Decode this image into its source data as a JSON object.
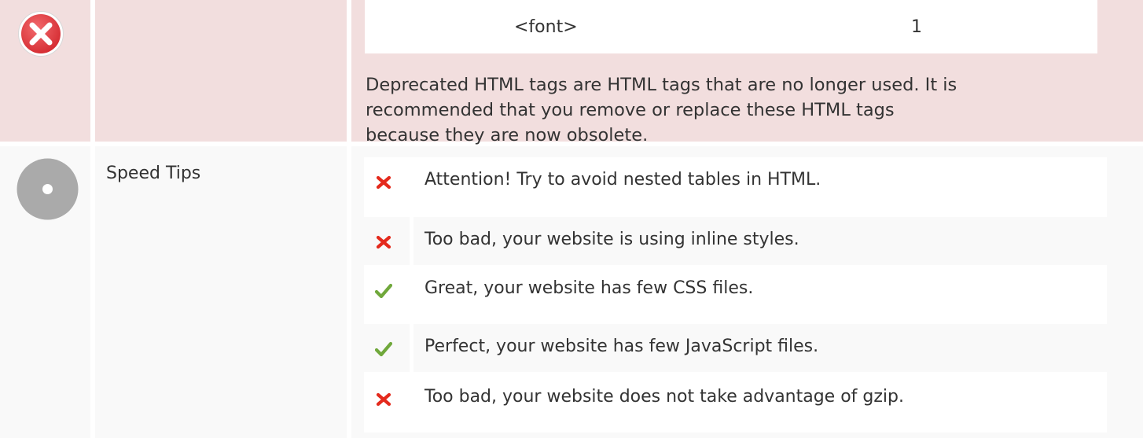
{
  "deprecated": {
    "status_icon": "error-circle-icon",
    "tag_name": "<font>",
    "tag_count": "1",
    "description": "Deprecated HTML tags are HTML tags that are no longer used. It is recommended that you remove or replace these HTML tags because they are now obsolete."
  },
  "speed_tips": {
    "status_icon": "neutral-circle-icon",
    "title": "Speed Tips",
    "tips": [
      {
        "status": "fail",
        "icon": "cross-icon",
        "text": "Attention! Try to avoid nested tables in HTML."
      },
      {
        "status": "fail",
        "icon": "cross-icon",
        "text": "Too bad, your website is using inline styles."
      },
      {
        "status": "pass",
        "icon": "check-icon",
        "text": "Great, your website has few CSS files."
      },
      {
        "status": "pass",
        "icon": "check-icon",
        "text": "Perfect, your website has few JavaScript files."
      },
      {
        "status": "fail",
        "icon": "cross-icon",
        "text": "Too bad, your website does not take advantage of gzip."
      }
    ]
  },
  "colors": {
    "error_bg": "#f2dede",
    "neutral_bg": "#f9f9f9",
    "fail_red": "#e42a1d",
    "pass_green": "#70a83b",
    "error_icon": "#e0383e",
    "neutral_icon": "#aaaaaa"
  }
}
